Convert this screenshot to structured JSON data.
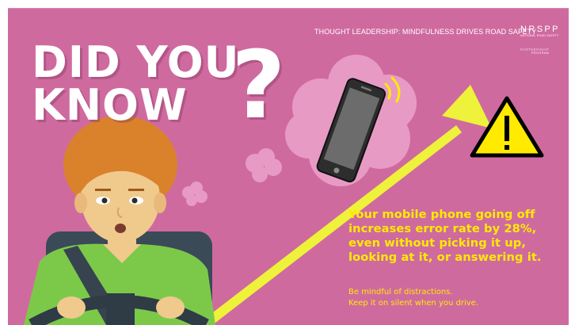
{
  "header": {
    "tag": "THOUGHT LEADERSHIP: MINDFULNESS DRIVES ROAD SAFETY",
    "brand_name": "NRSPP",
    "brand_sub": "NATIONAL ROAD SAFETY",
    "brand_prog1": "PARTNERSHIP",
    "brand_prog2": "PROGRAM"
  },
  "headline": {
    "line1": "DID YOU",
    "line2": "KNOW",
    "mark": "?"
  },
  "message": {
    "lines": [
      "Your mobile phone going off",
      "increases error rate by 28%,",
      "even without picking it up,",
      "looking at it, or answering it."
    ]
  },
  "tip": {
    "lines": [
      "Be mindful of distractions.",
      "Keep it on silent when you drive."
    ]
  },
  "icons": [
    "warning-icon",
    "phone-icon",
    "arrow-icon",
    "driver-illustration"
  ],
  "colors": {
    "background": "#cf6a9f",
    "accent": "#ffea00",
    "text": "#ffffff",
    "seat": "#3a4a57",
    "shirt": "#7cc94a",
    "hair": "#d9822b"
  }
}
